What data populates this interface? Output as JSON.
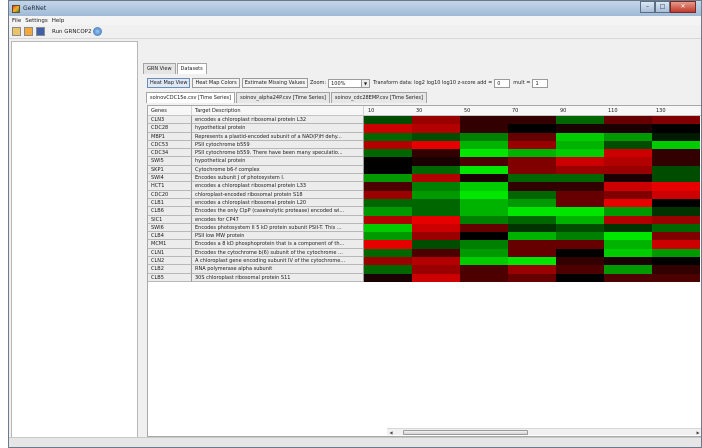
{
  "window": {
    "title": "GeRNet"
  },
  "menu": [
    "File",
    "Settings",
    "Help"
  ],
  "toolbar": {
    "run_label": "Run GRNCOP2"
  },
  "tabs": {
    "grn_view": "GRN View",
    "datasets": "Datasets"
  },
  "controls": {
    "heat_map_view": "Heat Map View",
    "heat_map_colors": "Heat Map Colors",
    "estimate_missing": "Estimate Missing Values",
    "zoom_label": "Zoom:",
    "zoom_value": "100%",
    "transform_label": "Transform data: log2  log10  log10  z-score  add =",
    "add_value": "0",
    "mult_label": "mult =",
    "mult_value": "1"
  },
  "datasets": [
    "soinovCDC15e.csv [Time Series]",
    "soinov_alpha24P.csv [Time Series]",
    "soinov_cdc28EMP.csv [Time Series]"
  ],
  "table": {
    "col_genes": "Genes",
    "col_desc": "Target Description",
    "timepoints": [
      "10",
      "30",
      "50",
      "70",
      "90",
      "110",
      "130"
    ],
    "rows": [
      {
        "gene": "CLN3",
        "desc": "encodes a chloroplast ribosomal protein L32"
      },
      {
        "gene": "CDC28",
        "desc": "hypothetical protein"
      },
      {
        "gene": "MBP1",
        "desc": "Represents a plastid-encoded subunit of a NAD(P)H dehy..."
      },
      {
        "gene": "CDC53",
        "desc": "PSII cytochrome b559"
      },
      {
        "gene": "CDC34",
        "desc": "PSII cytochrome b559. There have been many speculatio..."
      },
      {
        "gene": "SWI5",
        "desc": "hypothetical protein"
      },
      {
        "gene": "SKP1",
        "desc": "Cytochrome b6-f complex"
      },
      {
        "gene": "SWI4",
        "desc": "Encodes subunit J of photosystem I."
      },
      {
        "gene": "HCT1",
        "desc": "encodes a chloroplast ribosomal protein L33"
      },
      {
        "gene": "CDC20",
        "desc": "chloroplast-encoded ribosomal protein S18"
      },
      {
        "gene": "CLB1",
        "desc": "encodes a chloroplast ribosomal protein L20"
      },
      {
        "gene": "CLB6",
        "desc": "Encodes the only ClpP (caseinolytic protease) encoded wi..."
      },
      {
        "gene": "SIC1",
        "desc": "encodes for CP47"
      },
      {
        "gene": "SWI6",
        "desc": "Encodes photosystem II 5 kD protein subunit PSII-T. This ..."
      },
      {
        "gene": "CLB4",
        "desc": "PSII low MW protein"
      },
      {
        "gene": "MCM1",
        "desc": "Encodes a 8 kD phosphoprotein that is a component of th..."
      },
      {
        "gene": "CLN1",
        "desc": "Encodes the cytochrome b(6) subunit of the cytochrome ..."
      },
      {
        "gene": "CLN2",
        "desc": "A chloroplast gene encoding subunit IV of the cytochrome..."
      },
      {
        "gene": "CLB2",
        "desc": "RNA polymerase alpha subunit"
      },
      {
        "gene": "CLB5",
        "desc": "30S chloroplast ribosomal protein S11"
      }
    ],
    "heatmap": [
      [
        -0.3,
        0.6,
        0.2,
        0.2,
        -0.4,
        0.4,
        0.5
      ],
      [
        0.8,
        0.7,
        0.2,
        0.0,
        0.1,
        0.1,
        0.0
      ],
      [
        -0.4,
        -0.3,
        -0.5,
        0.4,
        -0.8,
        -0.6,
        -0.1
      ],
      [
        0.7,
        0.9,
        -0.7,
        0.6,
        -0.7,
        -0.3,
        -0.8
      ],
      [
        -0.4,
        0.2,
        -0.9,
        -0.7,
        -0.8,
        0.8,
        0.2
      ],
      [
        0.0,
        0.1,
        0.3,
        0.5,
        0.8,
        0.7,
        0.2
      ],
      [
        0.0,
        -0.4,
        -0.9,
        0.5,
        0.6,
        0.6,
        -0.3
      ],
      [
        -0.6,
        0.7,
        0.1,
        -0.4,
        -0.4,
        0.1,
        -0.3
      ],
      [
        0.3,
        -0.5,
        -0.8,
        0.2,
        0.2,
        0.8,
        0.9
      ],
      [
        0.6,
        -0.6,
        -0.9,
        -0.4,
        0.4,
        0.5,
        0.8
      ],
      [
        -0.4,
        -0.4,
        -0.7,
        -0.6,
        0.4,
        0.9,
        0.0
      ],
      [
        -0.6,
        -0.4,
        -0.7,
        -0.9,
        -0.9,
        -0.6,
        -0.2
      ],
      [
        0.7,
        0.9,
        -0.5,
        -0.4,
        -0.7,
        0.7,
        0.6
      ],
      [
        -0.8,
        0.8,
        0.4,
        -0.2,
        -0.3,
        -0.2,
        -0.4
      ],
      [
        -0.6,
        0.6,
        0.0,
        -0.7,
        -0.5,
        -0.9,
        0.5
      ],
      [
        0.9,
        -0.3,
        -0.5,
        0.4,
        0.4,
        -0.7,
        0.8
      ],
      [
        -0.4,
        0.3,
        -0.6,
        0.4,
        0.0,
        -0.8,
        -0.6
      ],
      [
        0.6,
        0.7,
        -0.8,
        -0.9,
        0.2,
        0.1,
        0.0
      ],
      [
        -0.4,
        0.6,
        0.3,
        0.6,
        0.3,
        -0.6,
        0.2
      ],
      [
        0.1,
        0.8,
        0.3,
        0.4,
        0.0,
        0.3,
        0.3
      ]
    ]
  },
  "colors": {
    "low": "#00ff00",
    "mid": "#000000",
    "high": "#ff0000"
  },
  "icons": {
    "open": "open-icon",
    "folder": "folder-icon",
    "save": "save-icon",
    "run": "run-icon"
  }
}
